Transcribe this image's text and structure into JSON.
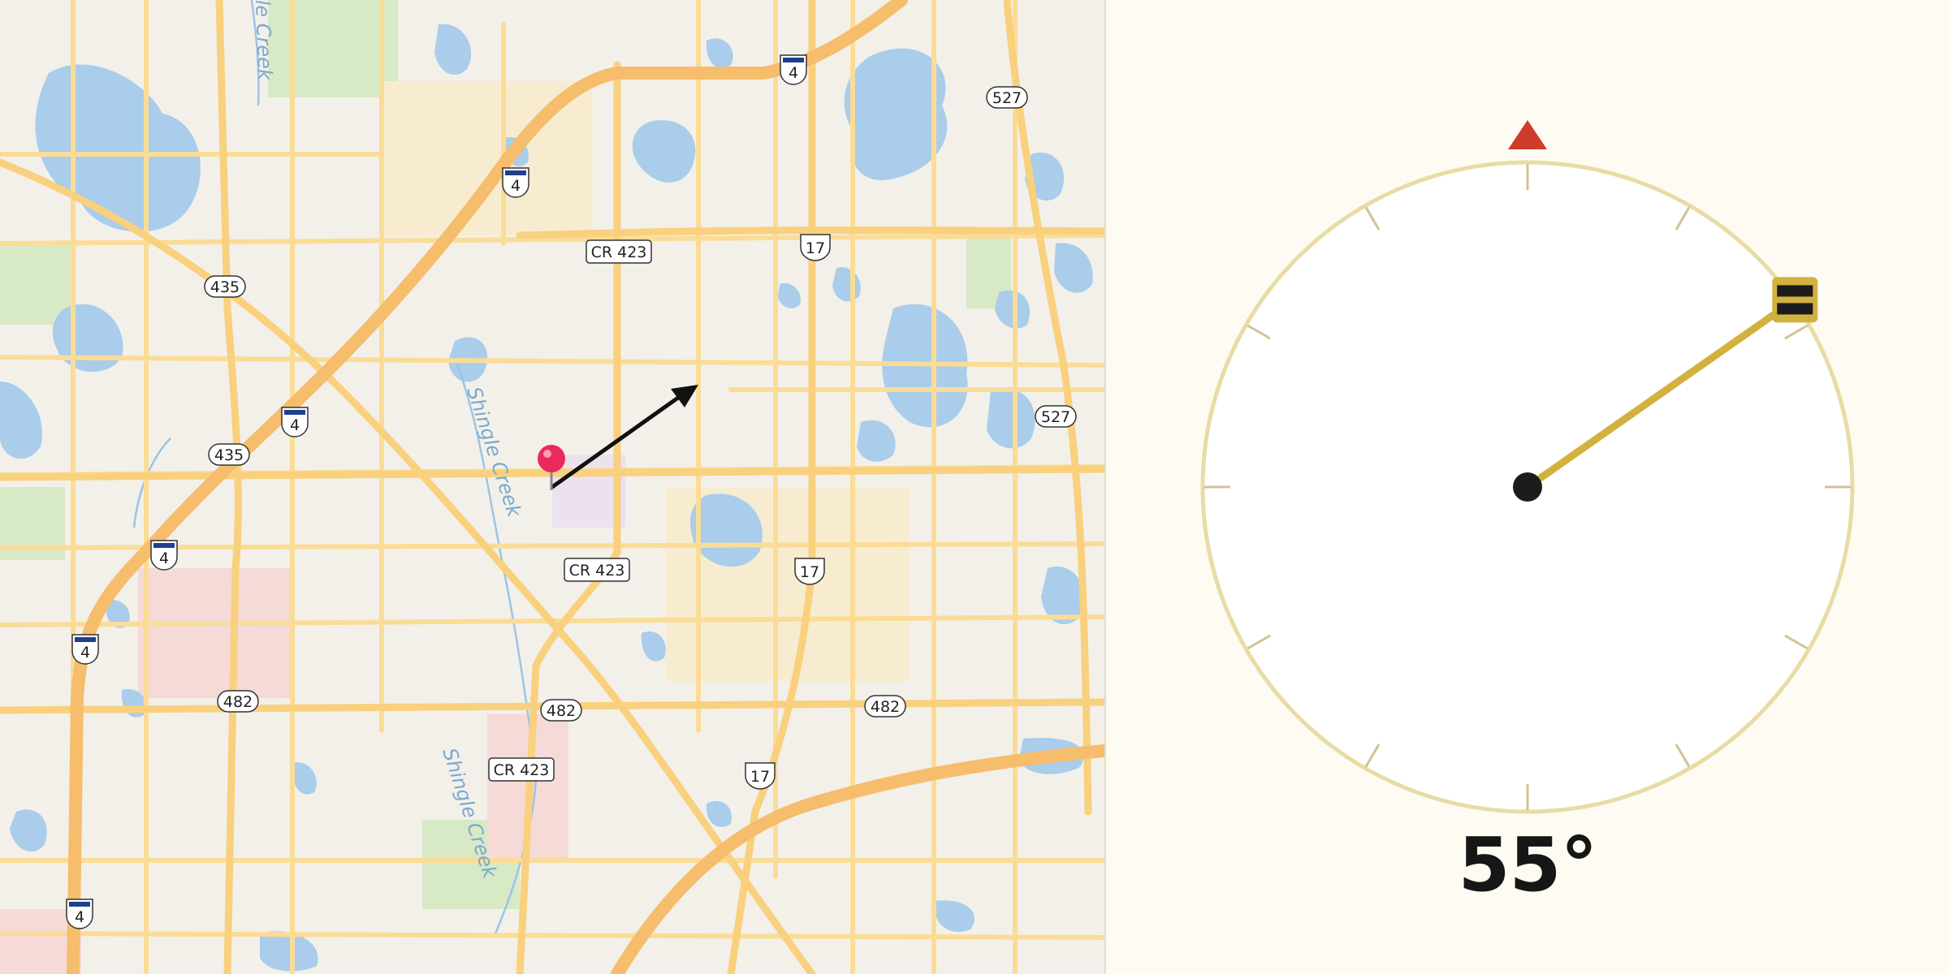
{
  "map": {
    "waterway_labels": [
      "Shingle Creek",
      "Shingle Creek",
      "le Creek"
    ],
    "road_labels": {
      "cr423": "CR 423",
      "r435": "435",
      "r482": "482",
      "r527": "527",
      "us17": "17",
      "i4": "4"
    },
    "colors": {
      "background": "#f3f0ea",
      "water": "#a9cdea",
      "park": "#d7e8c8",
      "road": "#fbdc96",
      "highway": "#f5bd6c",
      "pin": "#ea2a5c"
    }
  },
  "compass": {
    "heading_text": "55°",
    "heading_degrees": 55,
    "north_marker": "north-triangle",
    "colors": {
      "ring": "#e8dca5",
      "needle": "#d3b13f",
      "handle": "#1c1c1c",
      "north": "#cf3b2c",
      "hub": "#1c1c1c",
      "face": "#ffffff"
    }
  }
}
